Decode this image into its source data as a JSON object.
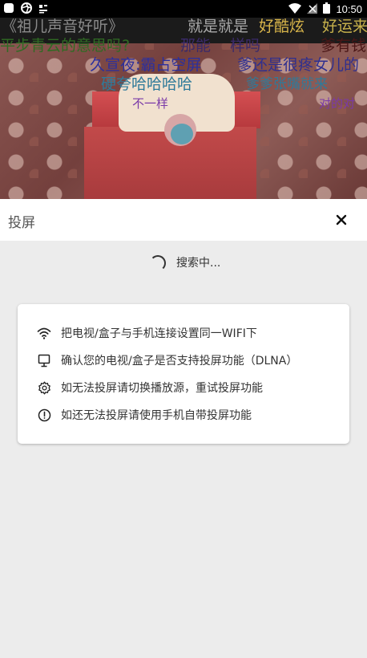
{
  "status_bar": {
    "time": "10:50",
    "left_icons": [
      "app-square-icon",
      "aperture-icon",
      "notification-icon"
    ],
    "right_icons": [
      "wifi-icon",
      "no-signal-icon",
      "battery-icon"
    ]
  },
  "danmaku": [
    {
      "text": "《祖儿声音好听》",
      "color": "#8a8a8a"
    },
    {
      "text": "就是就是",
      "color": "#a9a9a9"
    },
    {
      "text": "好酷炫",
      "color": "#d8b54a"
    },
    {
      "text": "好运来",
      "color": "#c8b24c"
    },
    {
      "text": "平步青云的意思吗?",
      "color": "#2f6b23"
    },
    {
      "text": "那能",
      "color": "#3a2a6a"
    },
    {
      "text": "样吗",
      "color": "#3a2a6a"
    },
    {
      "text": "爹有钱",
      "color": "#4a1616"
    },
    {
      "text": "久宣夜:霸占空屏",
      "color": "#2b2f9e"
    },
    {
      "text": "爹还是很疼女儿的",
      "color": "#2f2f8f"
    },
    {
      "text": "硬夸哈哈哈哈",
      "color": "#2f7a9a"
    },
    {
      "text": "爹爹张嘴就来",
      "color": "#2f7a9a"
    },
    {
      "text": "不一样",
      "color": "#7a3aa8"
    },
    {
      "text": "对的对",
      "color": "#7a3aa8"
    }
  ],
  "panel": {
    "title": "投屏",
    "searching_text": "搜索中..."
  },
  "tips": [
    {
      "icon": "wifi-icon",
      "text": "把电视/盒子与手机连接设置同一WIFI下"
    },
    {
      "icon": "monitor-icon",
      "text": "确认您的电视/盒子是否支持投屏功能（DLNA）"
    },
    {
      "icon": "gear-icon",
      "text": "如无法投屏请切换播放源，重试投屏功能"
    },
    {
      "icon": "info-icon",
      "text": "如还无法投屏请使用手机自带投屏功能"
    }
  ]
}
